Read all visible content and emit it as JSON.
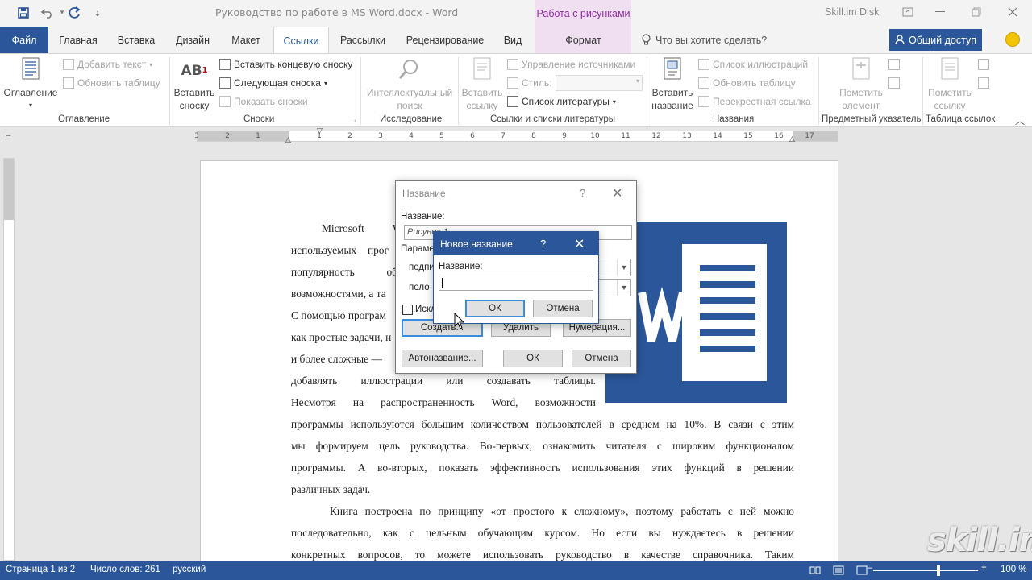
{
  "titlebar": {
    "doc_title": "Руководство по работе в MS Word.docx  -  Word",
    "tools_context": "Работа с рисунками",
    "account": "Skill.im Disk",
    "save_icon": "save-icon",
    "undo_icon": "undo-icon",
    "redo_icon": "redo-icon"
  },
  "tabs": [
    {
      "label": "Файл"
    },
    {
      "label": "Главная"
    },
    {
      "label": "Вставка"
    },
    {
      "label": "Дизайн"
    },
    {
      "label": "Макет"
    },
    {
      "label": "Ссылки"
    },
    {
      "label": "Рассылки"
    },
    {
      "label": "Рецензирование"
    },
    {
      "label": "Вид"
    },
    {
      "label": "Формат"
    }
  ],
  "tell_me": "Что вы хотите сделать?",
  "share": "Общий доступ",
  "ribbon": {
    "toc": {
      "big": "Оглавление",
      "add_text": "Добавить текст",
      "update_table": "Обновить таблицу",
      "group": "Оглавление"
    },
    "footnotes": {
      "insert_line1": "Вставить",
      "insert_line2": "сноску",
      "insert_endnote": "Вставить концевую сноску",
      "next_footnote": "Следующая сноска",
      "show_notes": "Показать сноски",
      "group": "Сноски"
    },
    "research": {
      "line1": "Интеллектуальный",
      "line2": "поиск",
      "group": "Исследование"
    },
    "citations": {
      "insert_line1": "Вставить",
      "insert_line2": "ссылку",
      "manage_sources": "Управление источниками",
      "style_label": "Стиль:",
      "bibliography": "Список литературы",
      "group": "Ссылки и списки литературы"
    },
    "captions": {
      "insert_line1": "Вставить",
      "insert_line2": "название",
      "table_of_figures": "Список иллюстраций",
      "update_table": "Обновить таблицу",
      "cross_reference": "Перекрестная ссылка",
      "group": "Названия"
    },
    "index": {
      "line1": "Пометить",
      "line2": "элемент",
      "group": "Предметный указатель"
    },
    "toa": {
      "line1": "Пометить",
      "line2": "ссылку",
      "group": "Таблица ссылок"
    }
  },
  "ruler": {
    "numbers": [
      "3",
      "2",
      "1",
      "1",
      "2",
      "3",
      "4",
      "5",
      "6",
      "7",
      "8",
      "9",
      "10",
      "11",
      "12",
      "13",
      "14",
      "15",
      "16",
      "17"
    ]
  },
  "document": {
    "lines_left": [
      {
        "words": [
          "Microsoft",
          "Wo"
        ]
      },
      {
        "words": [
          "используемых",
          "прог"
        ]
      },
      {
        "words": [
          "популярность",
          "об"
        ]
      },
      {
        "words": [
          "возможностями, а та"
        ]
      },
      {
        "words": [
          "С помощью програм"
        ]
      },
      {
        "words": [
          "как простые задачи, н"
        ]
      },
      {
        "words": [
          "и более сложные —"
        ]
      },
      {
        "words": [
          "добавлять",
          "иллюстрации",
          "или",
          "создавать",
          "таблицы."
        ]
      },
      {
        "words": [
          "Несмотря",
          "на",
          "распространенность",
          "Word,",
          "возможности"
        ]
      }
    ],
    "lines_full": [
      "программы используются большим количеством пользователей в среднем на 10%. В связи с этим",
      "мы формируем цель руководства. Во-первых, ознакомить читателя с широким функционалом",
      "программы. А во-вторых, показать эффективность использования этих функций в решении",
      "различных задач."
    ],
    "para2": [
      "Книга построена по принципу «от простого к сложному», поэтому работать с ней можно",
      "последовательно, как с цельным обучающим курсом. Но если вы нуждаетесь в решении",
      "конкретных вопросов, то можете использовать руководство в качестве справочника. Таким"
    ]
  },
  "caption_dialog": {
    "title": "Название",
    "help": "?",
    "caption_label": "Название:",
    "caption_value": "Рисунок 1",
    "params_label": "Парамет",
    "label_prefix": "подпи",
    "position_prefix": "поло",
    "exclude_label": "Искл",
    "new_label_btn": "Создать...",
    "delete_btn": "Удалить",
    "numbering_btn": "Нумерация...",
    "autocaption_btn": "Автоназвание...",
    "ok": "ОК",
    "cancel": "Отмена"
  },
  "new_label_dialog": {
    "title": "Новое название",
    "help": "?",
    "label": "Название:",
    "value": "",
    "ok": "ОК",
    "cancel": "Отмена"
  },
  "status": {
    "page": "Страница 1 из 2",
    "words": "Число слов: 261",
    "language": "русский",
    "zoom": "100 %"
  },
  "watermark": "skill.im",
  "colors": {
    "word_blue": "#2b579a",
    "tools_purple": "#8f2ea0",
    "tools_bg": "#f0dff0"
  }
}
